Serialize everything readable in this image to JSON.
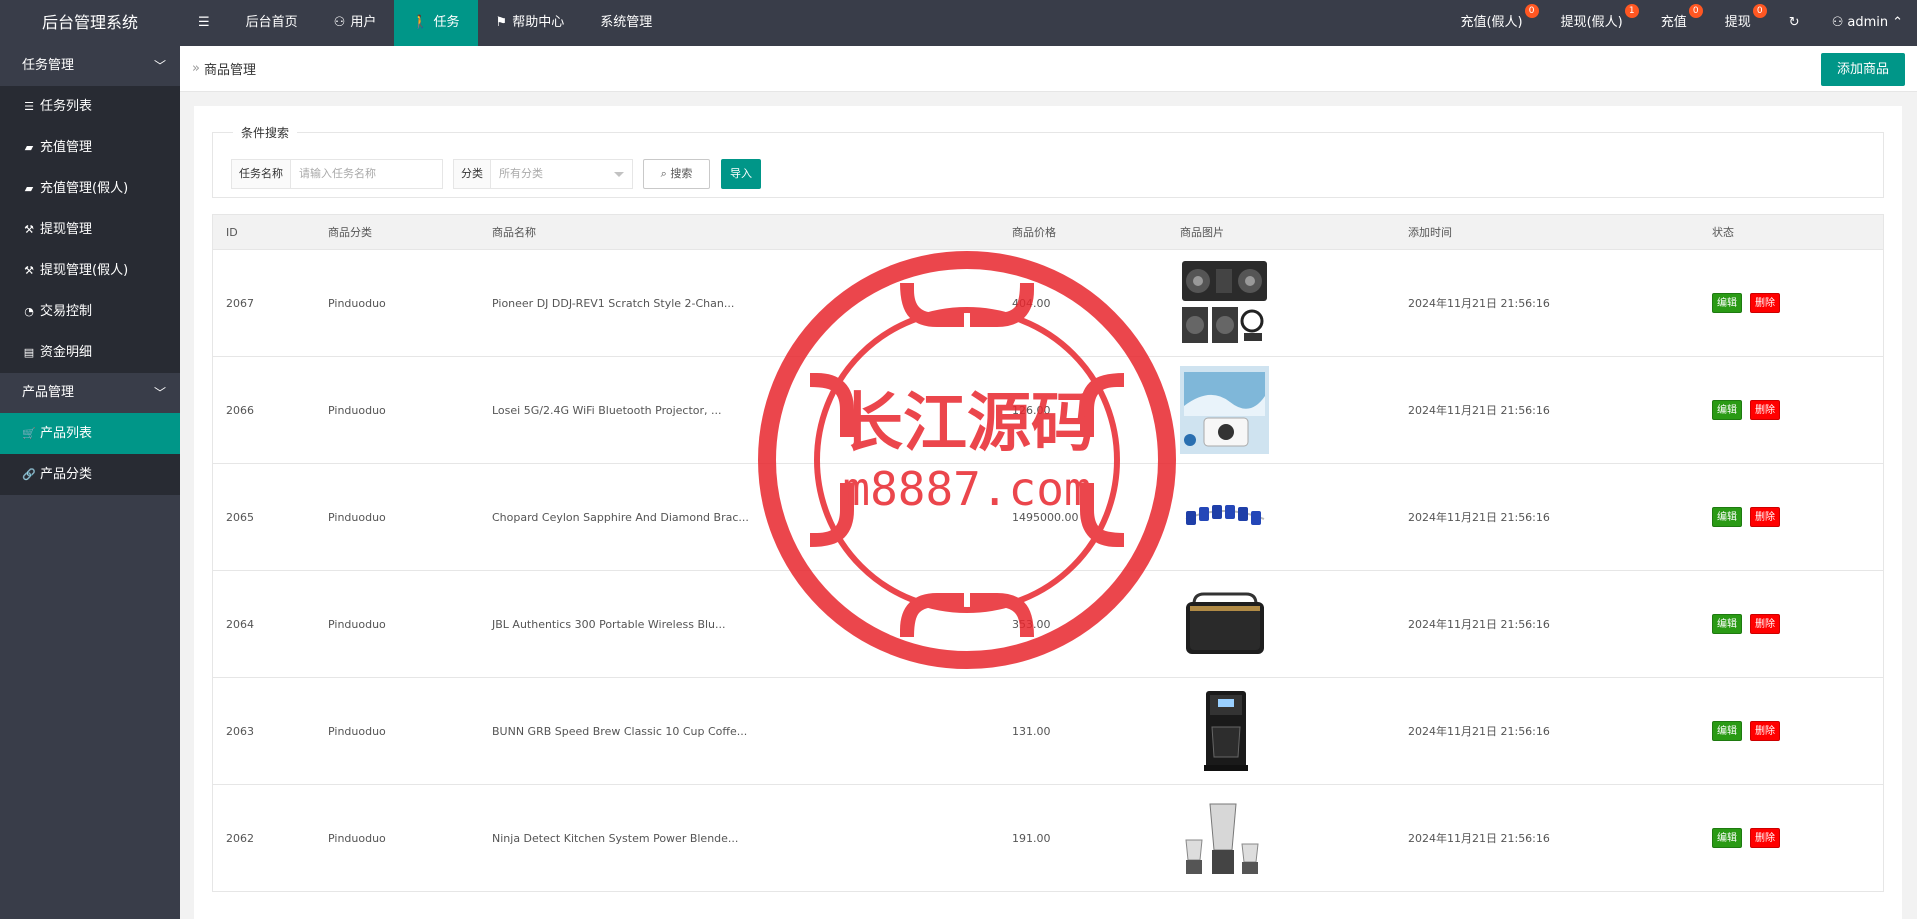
{
  "app": {
    "title": "后台管理系统"
  },
  "topnav": {
    "menu_icon": "menu-icon",
    "items": [
      {
        "label": "后台首页",
        "icon": ""
      },
      {
        "label": "用户",
        "icon": "user-icon"
      },
      {
        "label": "任务",
        "icon": "walk-icon"
      },
      {
        "label": "帮助中心",
        "icon": "flag-icon"
      },
      {
        "label": "系统管理",
        "icon": ""
      }
    ],
    "right": [
      {
        "label": "充值(假人)",
        "badge": "0"
      },
      {
        "label": "提现(假人)",
        "badge": "1"
      },
      {
        "label": "充值",
        "badge": "0"
      },
      {
        "label": "提现",
        "badge": "0"
      }
    ],
    "user": "admin"
  },
  "sidebar": {
    "groups": [
      {
        "label": "任务管理",
        "items": [
          "任务列表",
          "充值管理",
          "充值管理(假人)",
          "提现管理",
          "提现管理(假人)",
          "交易控制",
          "资金明细"
        ]
      },
      {
        "label": "产品管理",
        "items": [
          "产品列表",
          "产品分类"
        ]
      }
    ]
  },
  "breadcrumb": {
    "text": "商品管理"
  },
  "add_button": "添加商品",
  "search": {
    "legend": "条件搜索",
    "name_label": "任务名称",
    "name_placeholder": "请输入任务名称",
    "cat_label": "分类",
    "cat_value": "所有分类",
    "search_btn": "搜索",
    "import_btn": "导入"
  },
  "table": {
    "headers": [
      "ID",
      "商品分类",
      "商品名称",
      "商品价格",
      "商品图片",
      "添加时间",
      "状态"
    ],
    "rows": [
      {
        "id": "2067",
        "cat": "Pinduoduo",
        "name": "Pioneer DJ DDJ-REV1 Scratch Style 2-Chan...",
        "price": "404.00",
        "time": "2024年11月21日 21:56:16"
      },
      {
        "id": "2066",
        "cat": "Pinduoduo",
        "name": "Losei 5G/2.4G WiFi Bluetooth Projector, ...",
        "price": "126.00",
        "time": "2024年11月21日 21:56:16"
      },
      {
        "id": "2065",
        "cat": "Pinduoduo",
        "name": "Chopard Ceylon Sapphire And Diamond Brac...",
        "price": "1495000.00",
        "time": "2024年11月21日 21:56:16"
      },
      {
        "id": "2064",
        "cat": "Pinduoduo",
        "name": "JBL Authentics 300 Portable Wireless Blu...",
        "price": "353.00",
        "time": "2024年11月21日 21:56:16"
      },
      {
        "id": "2063",
        "cat": "Pinduoduo",
        "name": "BUNN GRB Speed Brew Classic 10 Cup Coffe...",
        "price": "131.00",
        "time": "2024年11月21日 21:56:16"
      },
      {
        "id": "2062",
        "cat": "Pinduoduo",
        "name": "Ninja Detect Kitchen System Power Blende...",
        "price": "191.00",
        "time": "2024年11月21日 21:56:16"
      }
    ],
    "edit_label": "编辑",
    "delete_label": "删除"
  },
  "watermark": {
    "line1": "长江源码",
    "line2": "m8887.com",
    "color": "#e8262d"
  }
}
